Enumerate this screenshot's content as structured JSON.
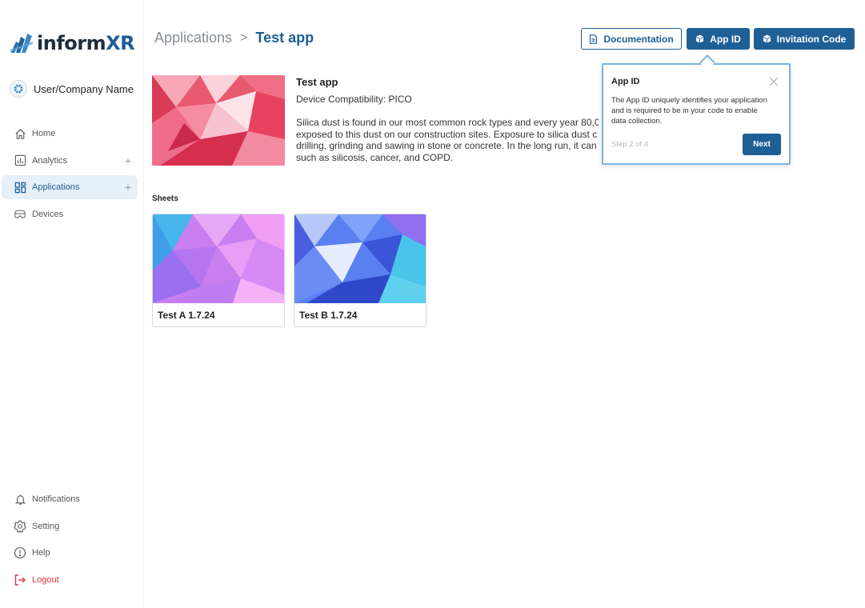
{
  "brand": {
    "name_main": "inform",
    "name_accent": "XR",
    "accent_color": "#1e5f96"
  },
  "user": {
    "name": "User/Company Name"
  },
  "sidebar": {
    "items": [
      {
        "label": "Home",
        "icon": "home-icon"
      },
      {
        "label": "Analytics",
        "icon": "analytics-icon",
        "expand": "+"
      },
      {
        "label": "Applications",
        "icon": "applications-icon",
        "expand": "+",
        "active": true
      },
      {
        "label": "Devices",
        "icon": "devices-icon"
      }
    ],
    "bottom_items": [
      {
        "label": "Notifications",
        "icon": "bell-icon"
      },
      {
        "label": "Setting",
        "icon": "gear-icon"
      },
      {
        "label": "Help",
        "icon": "help-icon"
      },
      {
        "label": "Logout",
        "icon": "logout-icon",
        "color": "#e0353a"
      }
    ]
  },
  "breadcrumb": {
    "root": "Applications",
    "separator": ">",
    "current": "Test app"
  },
  "header_buttons": {
    "documentation": "Documentation",
    "app_id": "App ID",
    "invitation_code": "Invitation Code"
  },
  "app": {
    "title": "Test app",
    "compatibility": "Device Compatibility: PICO",
    "description_lines": [
      "Silica dust is found in our most common rock types and every year 80,0",
      "exposed to this dust on our construction sites. Exposure to silica dust c",
      "drilling, grinding and sawing in stone or concrete. In the long run, it can",
      "such as silicosis, cancer, and COPD."
    ]
  },
  "sheets": {
    "label": "Sheets",
    "items": [
      {
        "label": "Test A 1.7.24"
      },
      {
        "label": "Test B 1.7.24"
      }
    ]
  },
  "popover": {
    "title": "App ID",
    "body": "The App ID uniquely identifies your application and is required to be in your code to enable data collection.",
    "step": "Step 2 of 4",
    "next_label": "Next"
  }
}
